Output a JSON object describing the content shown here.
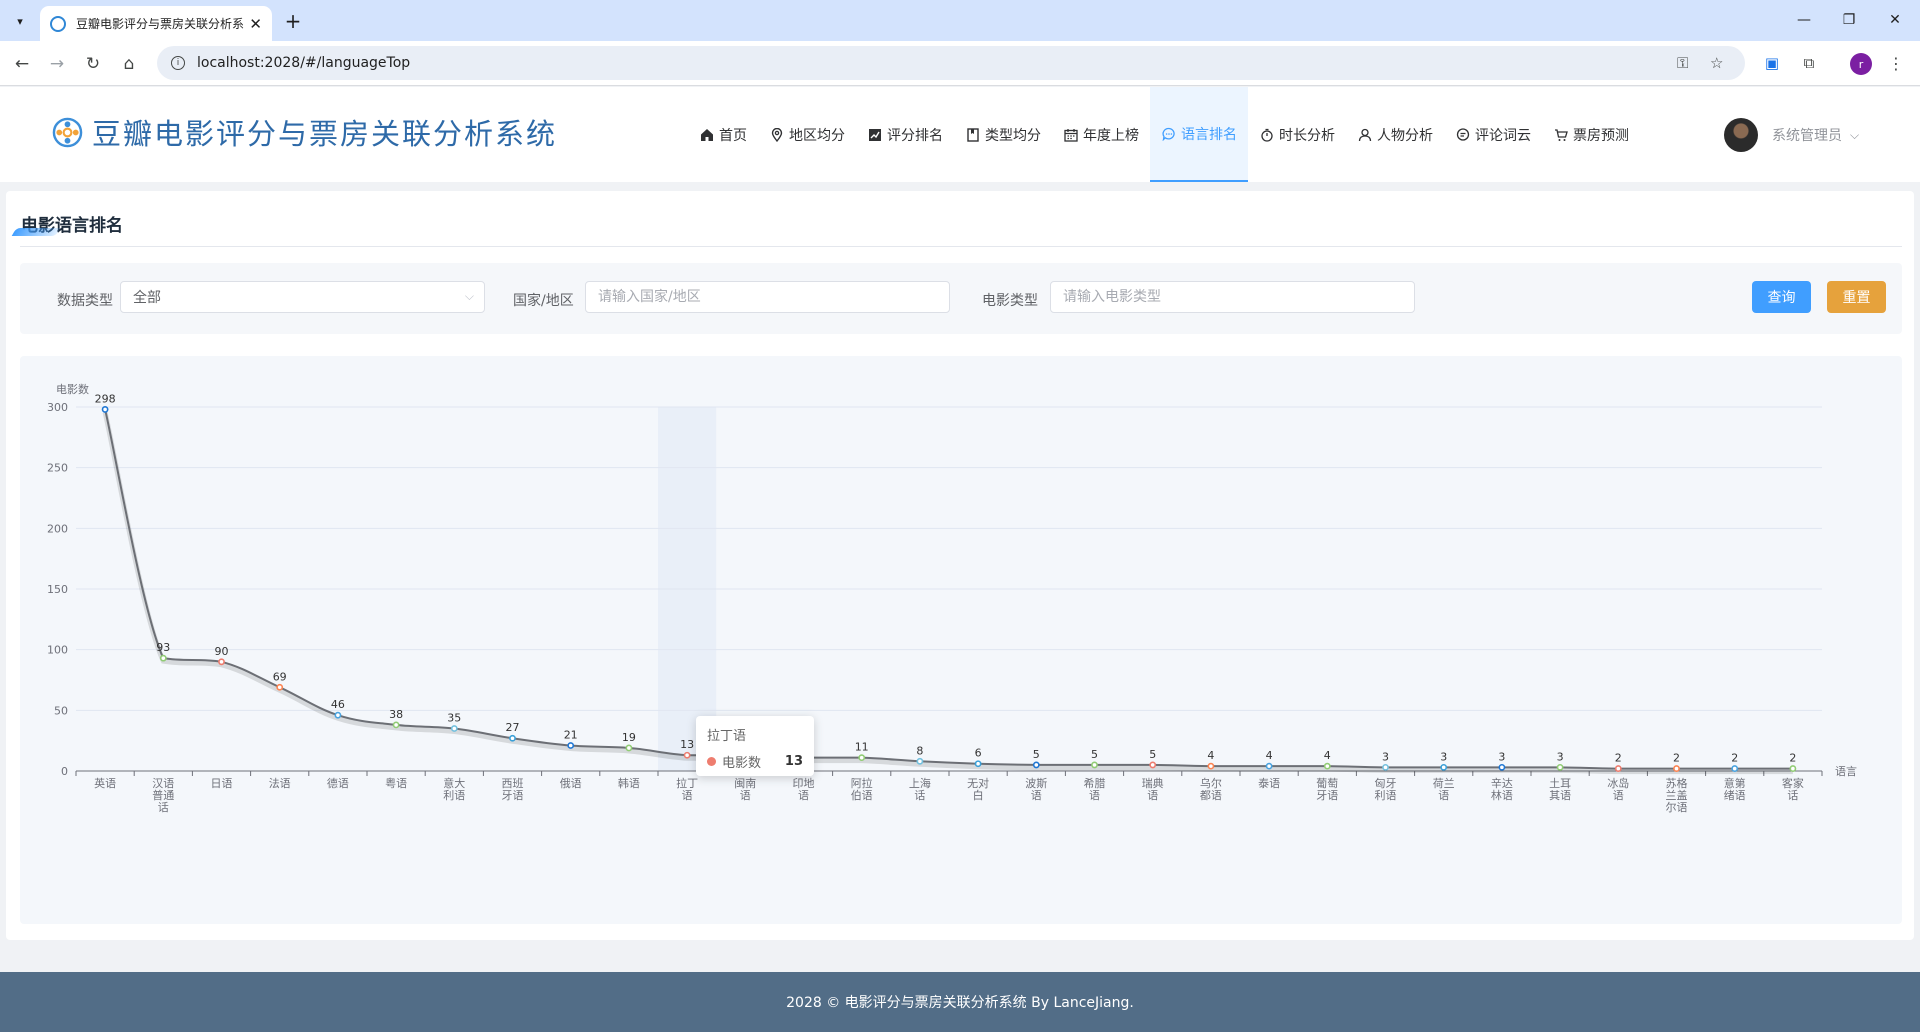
{
  "browser": {
    "tab_title": "豆瓣电影评分与票房关联分析系",
    "url": "localhost:2028/#/languageTop",
    "profile_initial": "r"
  },
  "app": {
    "title": "豆瓣电影评分与票房关联分析系统",
    "menu": [
      {
        "label": "首页",
        "icon": "home-icon"
      },
      {
        "label": "地区均分",
        "icon": "location-icon"
      },
      {
        "label": "评分排名",
        "icon": "trend-icon"
      },
      {
        "label": "类型均分",
        "icon": "notebook-icon"
      },
      {
        "label": "年度上榜",
        "icon": "calendar-icon"
      },
      {
        "label": "语言排名",
        "icon": "chat-icon",
        "active": true
      },
      {
        "label": "时长分析",
        "icon": "stopwatch-icon"
      },
      {
        "label": "人物分析",
        "icon": "user-icon"
      },
      {
        "label": "评论词云",
        "icon": "comment-icon"
      },
      {
        "label": "票房预测",
        "icon": "cart-icon"
      }
    ],
    "user_name": "系统管理员",
    "colors": {
      "brand": "#2e6aa8",
      "primary": "#409eff",
      "warning": "#e6a23c",
      "footer": "#526d87"
    }
  },
  "page": {
    "title": "电影语言排名",
    "filters": {
      "data_type_label": "数据类型",
      "data_type_value": "全部",
      "region_label": "国家/地区",
      "region_placeholder": "请输入国家/地区",
      "genre_label": "电影类型",
      "genre_placeholder": "请输入电影类型",
      "query_button": "查询",
      "reset_button": "重置"
    },
    "tooltip": {
      "title": "拉丁语",
      "series": "电影数",
      "value": "13"
    }
  },
  "chart_data": {
    "type": "line",
    "smooth": true,
    "ylabel": "电影数",
    "xlabel": "语言",
    "ylim": [
      0,
      300
    ],
    "yticks": [
      0,
      50,
      100,
      150,
      200,
      250,
      300
    ],
    "grid": true,
    "data_labels": true,
    "highlighted_category": "拉丁语",
    "categories": [
      "英语",
      "汉语普通话",
      "日语",
      "法语",
      "德语",
      "粤语",
      "意大利语",
      "西班牙语",
      "俄语",
      "韩语",
      "拉丁语",
      "闽南语",
      "印地语",
      "阿拉伯语",
      "上海话",
      "无对白",
      "波斯语",
      "希腊语",
      "瑞典语",
      "乌尔都语",
      "泰语",
      "葡萄牙语",
      "匈牙利语",
      "荷兰语",
      "辛达林语",
      "土耳其语",
      "冰岛语",
      "苏格兰盖尔语",
      "意第绪语",
      "客家话"
    ],
    "series": [
      {
        "name": "电影数",
        "values": [
          298,
          93,
          90,
          69,
          46,
          38,
          35,
          27,
          21,
          19,
          13,
          13,
          11,
          11,
          8,
          6,
          5,
          5,
          5,
          4,
          4,
          4,
          3,
          3,
          3,
          3,
          2,
          2,
          2,
          2
        ]
      }
    ],
    "point_colors": [
      "#1f77d4",
      "#91cc75",
      "#ee7d6f",
      "#fc8452",
      "#4aa3df",
      "#91cc75",
      "#73c0de",
      "#3ba0d8"
    ]
  },
  "footer": {
    "text": "2028 © 电影评分与票房关联分析系统 By LanceJiang."
  }
}
